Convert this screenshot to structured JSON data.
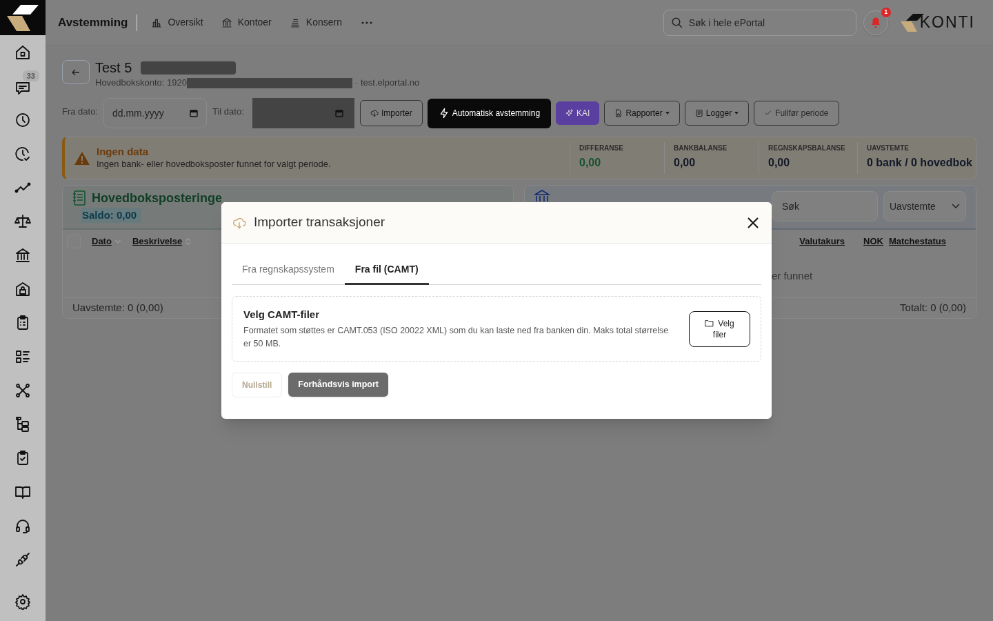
{
  "sidebar": {
    "chat_badge": "33"
  },
  "header": {
    "title": "Avstemming",
    "nav": [
      {
        "label": "Oversikt",
        "kind": "chart"
      },
      {
        "label": "Kontoer",
        "kind": "bank"
      },
      {
        "label": "Konsern",
        "kind": "stack"
      }
    ],
    "search_placeholder": "Søk i hele ePortal",
    "notification_count": "1",
    "brand": "KONTI"
  },
  "page": {
    "title": "Test 5",
    "account": "Hovedbokskonto: 1920",
    "host": "· test.elportal.no"
  },
  "filters": {
    "from_label": "Fra dato:",
    "from_placeholder": "dd.mm.yyyy",
    "to_label": "Til dato:"
  },
  "toolbar": [
    {
      "label": "Importer",
      "kind": "import"
    },
    {
      "label": "Automatisk avstemming",
      "kind": "primary"
    },
    {
      "label": "KAI",
      "kind": "ai"
    },
    {
      "label": "Rapporter",
      "kind": "report"
    },
    {
      "label": "Logger",
      "kind": "log"
    },
    {
      "label": "Fullfør periode",
      "kind": "complete"
    }
  ],
  "alert": {
    "title": "Ingen data",
    "message": "Ingen bank- eller hovedboksposter funnet for valgt periode."
  },
  "stats": [
    {
      "label": "DIFFERANSE",
      "value": "0,00",
      "color": "#14532d"
    },
    {
      "label": "BANKBALANSE",
      "value": "0,00",
      "color": "#111827"
    },
    {
      "label": "REGNSKAPSBALANSE",
      "value": "0,00",
      "color": "#111827"
    },
    {
      "label": "UAVSTEMTE",
      "value": "0 bank / 0 hovedbok",
      "color": "#111827"
    }
  ],
  "ledger": {
    "title": "Hovedboksposteringe",
    "saldo": "Saldo: 0,00",
    "select_all_checked": false,
    "columns": [
      "Dato",
      "Beskrivelse"
    ],
    "footer": "Uavstemte: 0 (0,00)"
  },
  "bank": {
    "search_placeholder": "Søk",
    "filter": "Uavstemte",
    "columns": [
      "Valutakurs",
      "NOK",
      "Matchestatus"
    ],
    "empty": "er funnet",
    "footer": "Totalt: 0 (0,00)"
  },
  "modal": {
    "title": "Importer transaksjoner",
    "tabs": [
      {
        "label": "Fra regnskapssystem",
        "selected": false
      },
      {
        "label": "Fra fil (CAMT)",
        "selected": true
      }
    ],
    "upload_title": "Velg CAMT-filer",
    "upload_text": "Formatet som støttes er CAMT.053 (ISO 20022 XML) som du kan laste ned fra banken din. Maks total størrelse er 50 MB.",
    "choose_button": "Velg filer",
    "actions": [
      {
        "label": "Nullstill",
        "disabled": true
      },
      {
        "label": "Forhåndsvis import",
        "disabled": false
      }
    ]
  }
}
